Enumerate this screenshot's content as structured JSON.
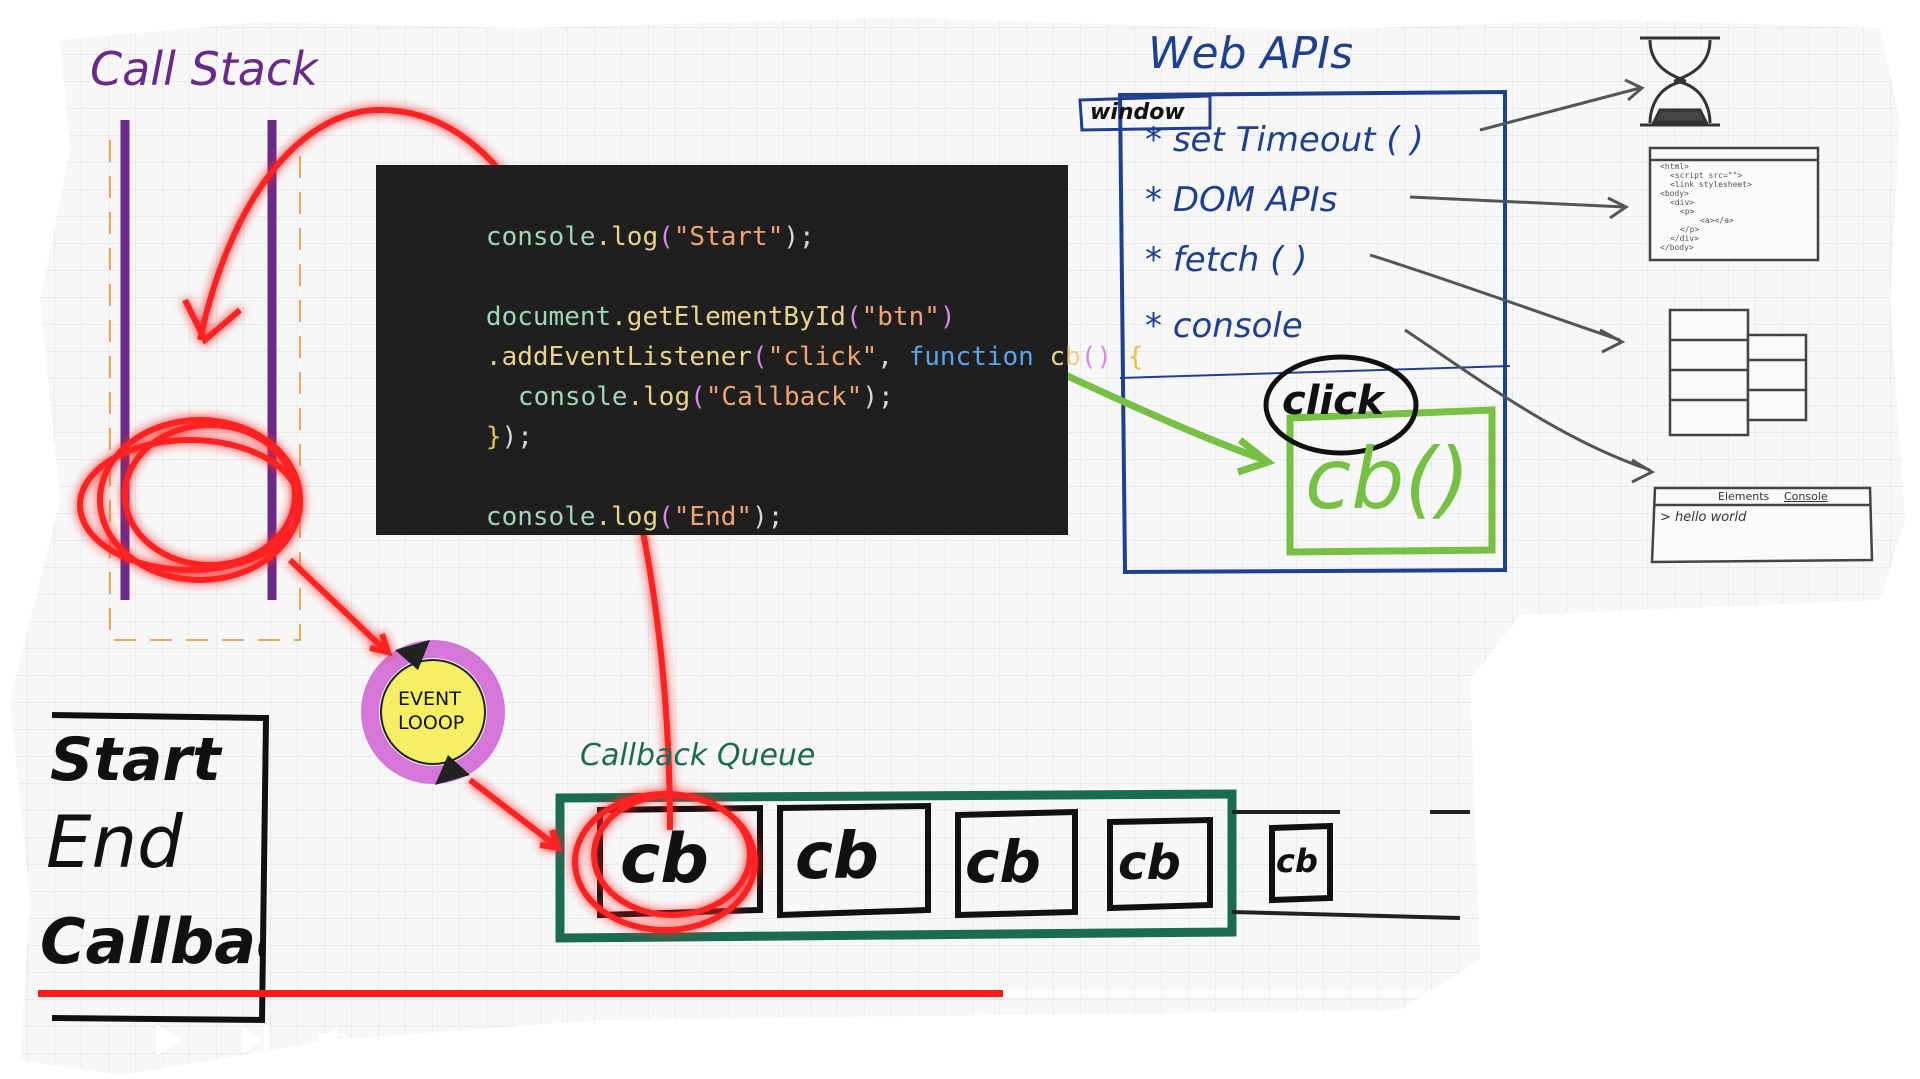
{
  "whiteboard": {
    "call_stack_title": "Call Stack",
    "web_apis_title": "Web APIs",
    "window_tag": "window",
    "web_api_items": [
      "set Timeout ( )",
      "DOM APIs",
      "fetch ( )",
      "console"
    ],
    "bullet": "*",
    "click_label": "click",
    "cb_box_label": "cb()",
    "event_loop_line1": "EVENT",
    "event_loop_line2": "LOOOP",
    "callback_queue_title": "Callback Queue",
    "queue_items": [
      "cb",
      "cb",
      "cb",
      "cb",
      "cb"
    ],
    "console_output": [
      "Start",
      "End",
      "Callback"
    ],
    "browser_console_tabs": [
      "Elements",
      "Console"
    ],
    "browser_console_output": "> hello world",
    "html_snippet_lines": [
      "<html>",
      "<script src=\"\">",
      "<link stylesheet>",
      "<body>",
      "<div>",
      "<p>",
      "<a></a>",
      "</p>",
      "</div>",
      "</body>"
    ]
  },
  "code": {
    "line1": {
      "obj": "console",
      "fn": ".log",
      "open": "(",
      "str": "\"Start\"",
      "close": ");"
    },
    "line3": {
      "obj": "document",
      "fn": ".getElementById",
      "open": "(",
      "str": "\"btn\"",
      "close": ")"
    },
    "line4": {
      "fn": ".addEventListener",
      "open": "(",
      "str": "\"click\"",
      "comma": ", ",
      "kw": "function",
      "space": " ",
      "name": "cb",
      "parens": "()",
      "brace": " {"
    },
    "line5": {
      "obj": "console",
      "fn": ".log",
      "open": "(",
      "str": "\"Callback\"",
      "close": ");"
    },
    "line6": {
      "brace": "}",
      "close": ");"
    },
    "line8": {
      "obj": "console",
      "fn": ".log",
      "open": "(",
      "str": "\"End\"",
      "close": ");"
    }
  },
  "player": {
    "progress": 0.67,
    "progress_color": "#ff1a1a",
    "play_icon": "play-icon",
    "next_icon": "next-icon",
    "volume_icon": "volume-icon"
  },
  "colors": {
    "call_stack": "#6a2a8a",
    "web_apis": "#1f3f8f",
    "callback_queue": "#1b6b52",
    "annotation_red": "#ff2020",
    "annotation_green": "#76c043",
    "event_loop_fill": "#f4ef63",
    "event_loop_ring": "#d477d8"
  }
}
